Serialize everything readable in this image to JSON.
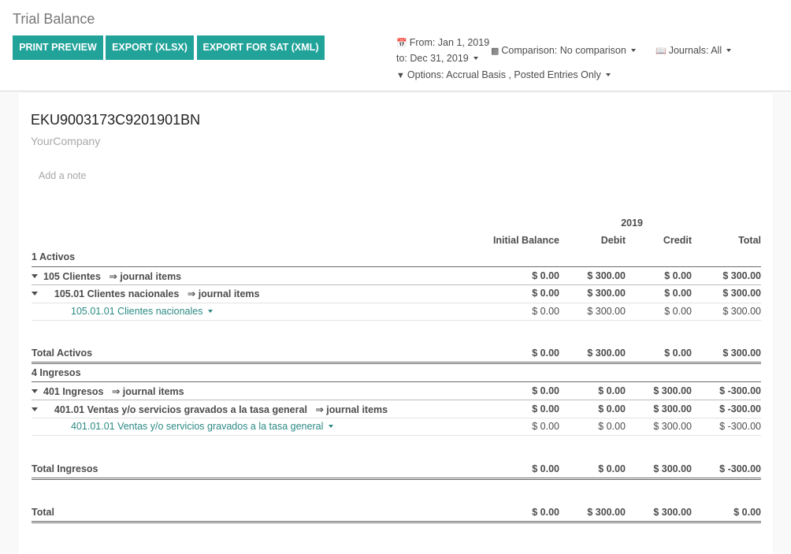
{
  "header": {
    "title": "Trial Balance",
    "buttons": {
      "print_preview": "PRINT PREVIEW",
      "export_xlsx": "EXPORT (XLSX)",
      "export_sat": "EXPORT FOR SAT (XML)"
    },
    "filters": {
      "date_from": "From: Jan 1, 2019",
      "date_to": "to: Dec 31, 2019",
      "comparison": "Comparison: No comparison",
      "journals": "Journals: All",
      "options": "Options: Accrual Basis , Posted Entries Only"
    }
  },
  "report": {
    "company_vat": "EKU9003173C9201901BN",
    "company_name": "YourCompany",
    "add_note": "Add a note",
    "period_header": "2019",
    "columns": [
      "Initial Balance",
      "Debit",
      "Credit",
      "Total"
    ],
    "journal_items_label": "⇒ journal items",
    "sections": {
      "activos": {
        "title": "1 Activos",
        "account": {
          "label": "105 Clientes",
          "values": [
            "$ 0.00",
            "$ 300.00",
            "$ 0.00",
            "$ 300.00"
          ]
        },
        "subaccount": {
          "label": "105.01 Clientes nacionales",
          "values": [
            "$ 0.00",
            "$ 300.00",
            "$ 0.00",
            "$ 300.00"
          ]
        },
        "leaf": {
          "label": "105.01.01 Clientes nacionales",
          "values": [
            "$ 0.00",
            "$ 300.00",
            "$ 0.00",
            "$ 300.00"
          ]
        },
        "total": {
          "label": "Total Activos",
          "values": [
            "$ 0.00",
            "$ 300.00",
            "$ 0.00",
            "$ 300.00"
          ]
        }
      },
      "ingresos": {
        "title": "4 Ingresos",
        "account": {
          "label": "401 Ingresos",
          "values": [
            "$ 0.00",
            "$ 0.00",
            "$ 300.00",
            "$ -300.00"
          ]
        },
        "subaccount": {
          "label": "401.01 Ventas y/o servicios gravados a la tasa general",
          "values": [
            "$ 0.00",
            "$ 0.00",
            "$ 300.00",
            "$ -300.00"
          ]
        },
        "leaf": {
          "label": "401.01.01 Ventas y/o servicios gravados a la tasa general",
          "values": [
            "$ 0.00",
            "$ 0.00",
            "$ 300.00",
            "$ -300.00"
          ]
        },
        "total": {
          "label": "Total Ingresos",
          "values": [
            "$ 0.00",
            "$ 0.00",
            "$ 300.00",
            "$ -300.00"
          ]
        }
      }
    },
    "grand_total": {
      "label": "Total",
      "values": [
        "$ 0.00",
        "$ 300.00",
        "$ 300.00",
        "$ 0.00"
      ]
    }
  }
}
